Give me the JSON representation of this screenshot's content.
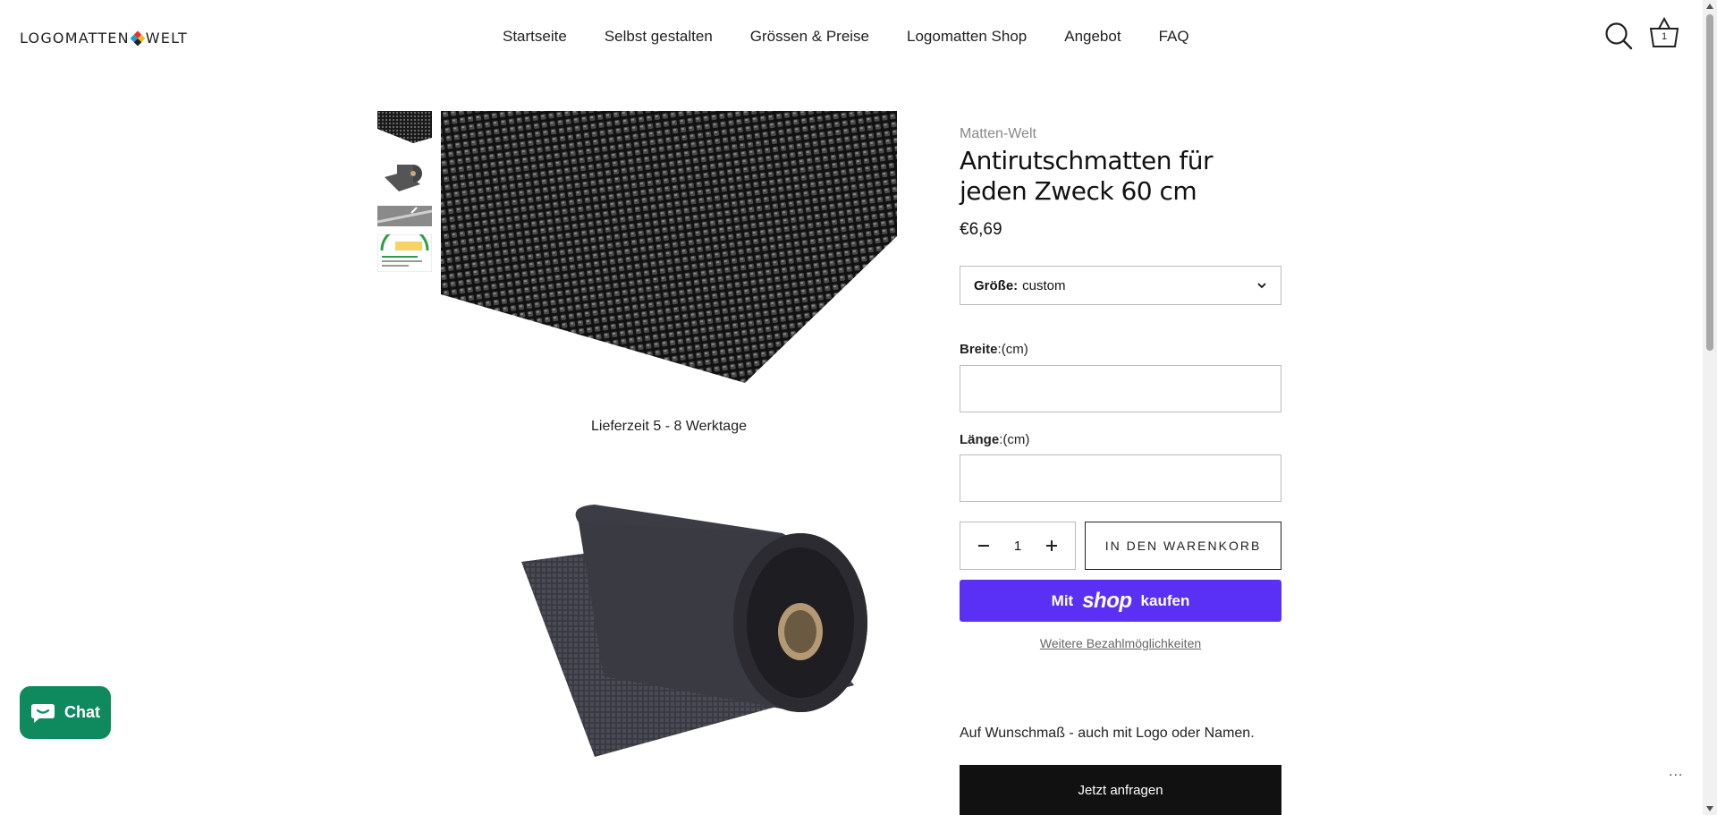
{
  "header": {
    "logo_left": "LOGOMATTEN",
    "logo_right": "WELT",
    "nav": [
      "Startseite",
      "Selbst gestalten",
      "Grössen & Preise",
      "Logomatten Shop",
      "Angebot",
      "FAQ"
    ],
    "cart_count": "1",
    "icons": {
      "search": "search-icon",
      "cart": "cart-icon"
    }
  },
  "gallery": {
    "caption": "Lieferzeit 5 - 8 Werktage"
  },
  "product": {
    "vendor": "Matten-Welt",
    "title": "Antirutschmatten für jeden Zweck 60 cm",
    "price": "€6,69",
    "size": {
      "label": "Größe:",
      "value": "custom"
    },
    "width_field": {
      "label": "Breite",
      "unit": ":(cm)",
      "value": ""
    },
    "length_field": {
      "label": "Länge",
      "unit": ":(cm)",
      "value": ""
    },
    "quantity": "1",
    "add_to_cart": "IN DEN WARENKORB",
    "shop_pay": {
      "prefix": "Mit",
      "brand": "shop",
      "suffix": "kaufen"
    },
    "more_payment": "Weitere Bezahlmöglichkeiten",
    "description": "Auf Wunschmaß - auch mit Logo oder Namen.",
    "inquire": "Jetzt anfragen"
  },
  "chat": {
    "label": "Chat"
  },
  "colors": {
    "shop_pay": "#5a31f4",
    "chat": "#0f8a5f",
    "inquire": "#111111"
  },
  "misc": {
    "dots": "..."
  }
}
